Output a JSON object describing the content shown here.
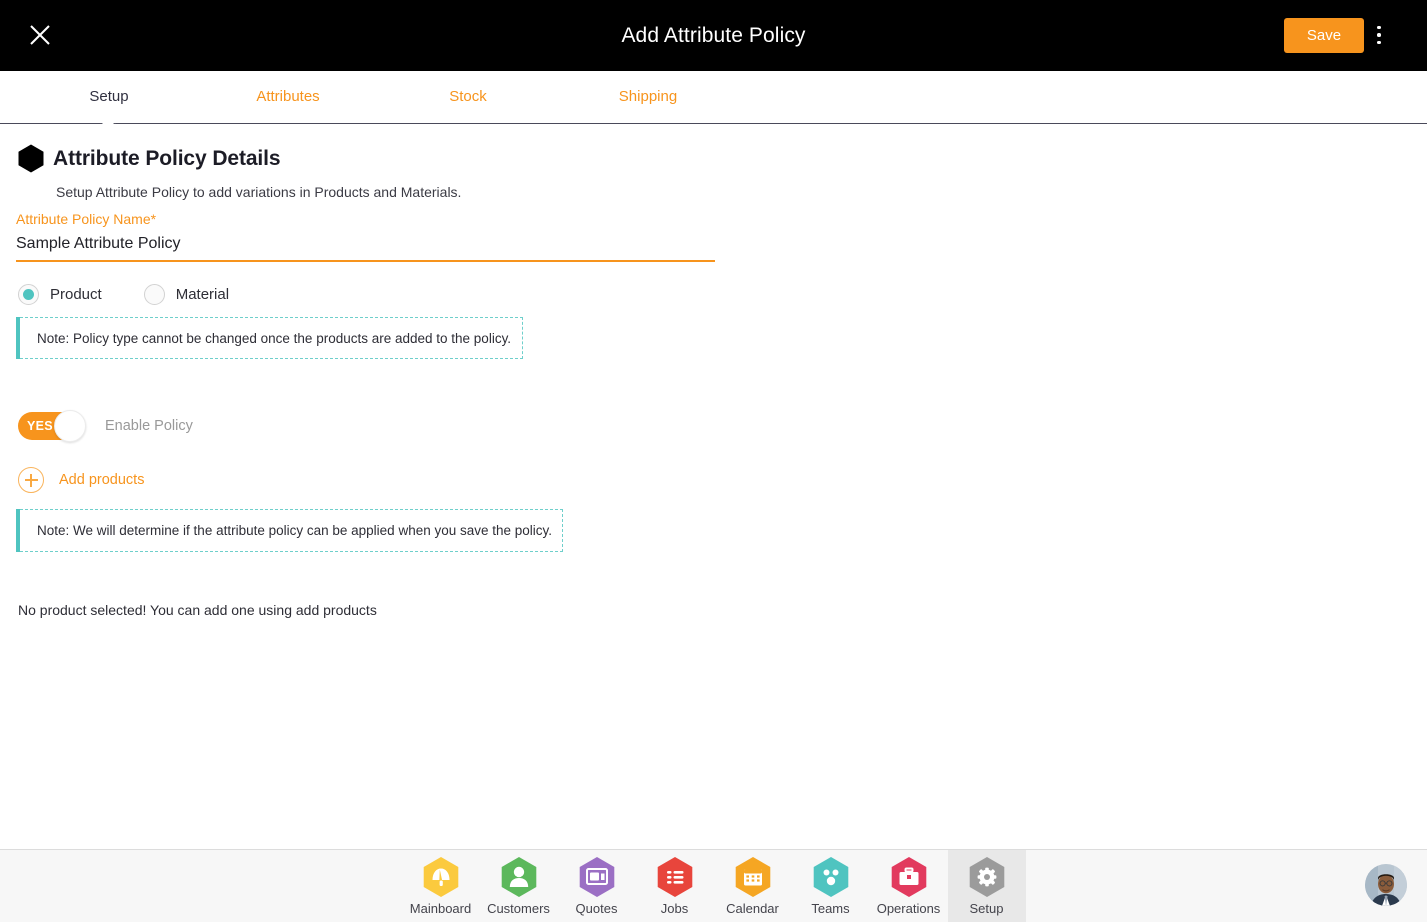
{
  "header": {
    "title": "Add Attribute Policy",
    "close_icon": "close-icon",
    "save_label": "Save",
    "menu_icon": "kebab-menu-icon",
    "accent_color": "#f7941d",
    "background_color": "#000000"
  },
  "tabs": [
    {
      "label": "Setup",
      "active": true
    },
    {
      "label": "Attributes",
      "active": false
    },
    {
      "label": "Stock",
      "active": false
    },
    {
      "label": "Shipping",
      "active": false
    }
  ],
  "main": {
    "section_icon": "hexagon-bullet-icon",
    "section_title": "Attribute Policy Details",
    "section_subtitle": "Setup Attribute Policy to add variations in Products and Materials.",
    "policy_name_label": "Attribute Policy Name",
    "policy_name_required": "*",
    "policy_name_value": "Sample Attribute Policy",
    "policy_name_placeholder": "Attribute Policy Name",
    "policy_type_options": [
      {
        "label": "Product",
        "selected": true
      },
      {
        "label": "Material",
        "selected": false
      }
    ],
    "note_policy_type": "Note: Policy type cannot be changed once the products are added to the policy.",
    "toggle_state_label": "YES",
    "toggle_caption": "Enable Policy",
    "add_products_label": "Add products",
    "add_products_icon": "plus-circle-icon",
    "note_apply_policy": "Note: We will determine if the attribute policy can be applied when you save the policy.",
    "empty_message": "No product selected! You can add one using add products",
    "teal_color": "#4fc4c0",
    "orange_color": "#f7941d"
  },
  "bottom_nav": {
    "items": [
      {
        "label": "Mainboard",
        "icon": "dashboard-gauge-icon",
        "color": "#fbca3e",
        "active": false
      },
      {
        "label": "Customers",
        "icon": "person-icon",
        "color": "#5cb85c",
        "active": false
      },
      {
        "label": "Quotes",
        "icon": "quote-card-icon",
        "color": "#9b6fc4",
        "active": false
      },
      {
        "label": "Jobs",
        "icon": "task-list-icon",
        "color": "#e8453c",
        "active": false
      },
      {
        "label": "Calendar",
        "icon": "calendar-icon",
        "color": "#f5a623",
        "active": false
      },
      {
        "label": "Teams",
        "icon": "team-dots-icon",
        "color": "#4fc4c0",
        "active": false
      },
      {
        "label": "Operations",
        "icon": "briefcase-icon",
        "color": "#e23a5e",
        "active": false
      },
      {
        "label": "Setup",
        "icon": "gear-icon",
        "color": "#9b9b9b",
        "active": true
      }
    ],
    "avatar_icon": "user-avatar-photo",
    "background_color": "#f7f7f7"
  }
}
